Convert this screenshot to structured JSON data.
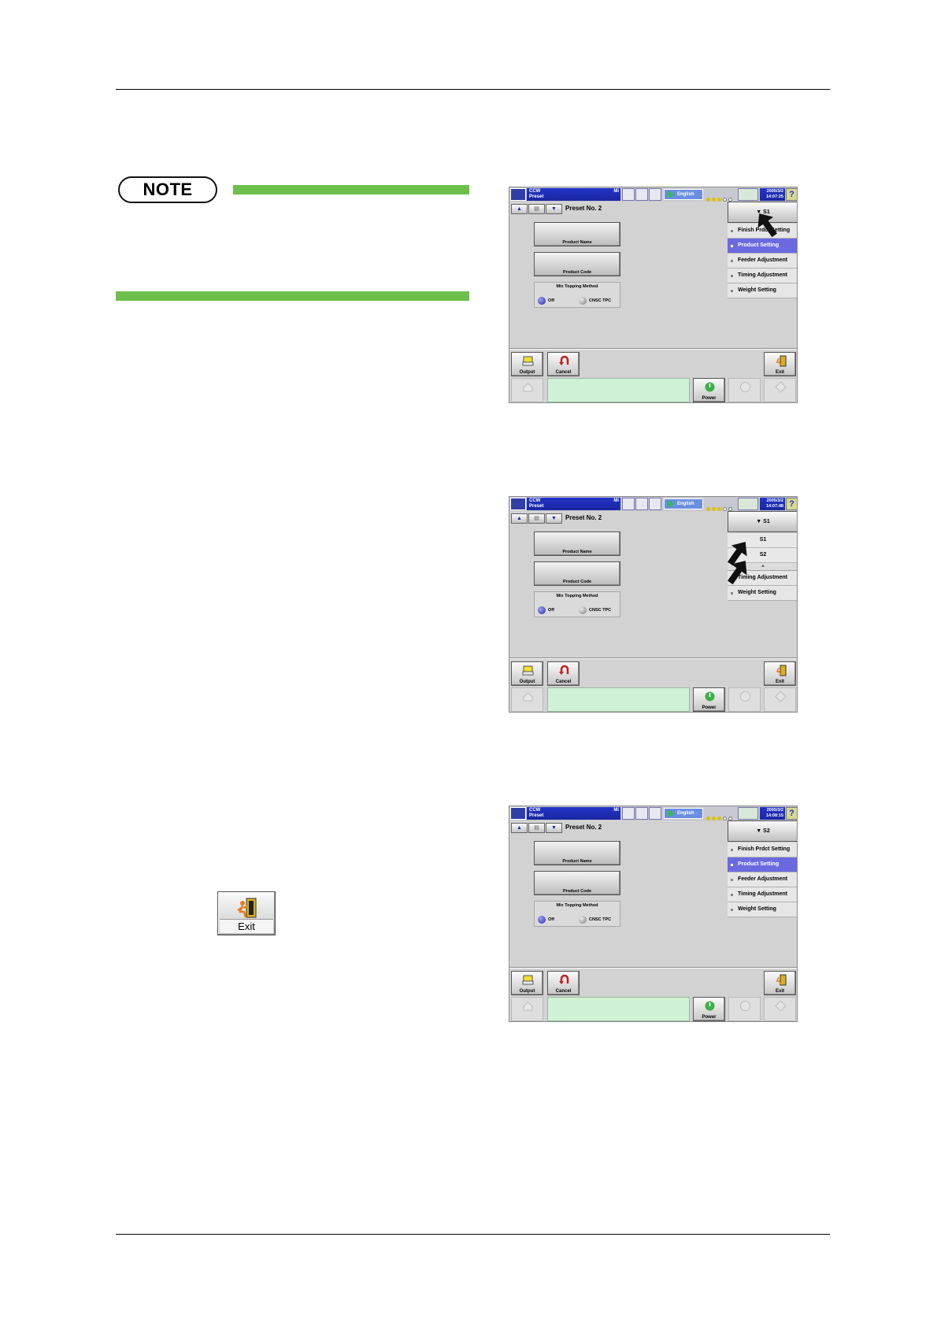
{
  "note": {
    "label": "NOTE"
  },
  "exit_button": {
    "label": "Exit"
  },
  "screens": [
    {
      "mode_line1": "CCW",
      "mode_line2": "Preset",
      "mode_flag": "Mi",
      "language": "English",
      "date": "2005/3/2",
      "time": "14:07:25",
      "preset_title": "Preset No. 2",
      "product_name_label": "Product Name",
      "product_code_label": "Product Code",
      "mix_title": "Mix Topping Method",
      "radio_off": "Off",
      "radio_cnsc": "CNSC TPC",
      "dropdown": "▼ S1",
      "menu": [
        "Finish Prdct Setting",
        "Product Setting",
        "Feeder Adjustment",
        "Timing Adjustment",
        "Weight Setting"
      ],
      "selected_index": 1,
      "btn_output": "Output",
      "btn_cancel": "Cancel",
      "btn_exit": "Exit",
      "btn_power": "Power"
    },
    {
      "mode_line1": "CCW",
      "mode_line2": "Preset",
      "mode_flag": "Mi",
      "language": "English",
      "date": "2005/3/2",
      "time": "14:07:48",
      "preset_title": "Preset No. 2",
      "product_name_label": "Product Name",
      "product_code_label": "Product Code",
      "mix_title": "Mix Topping Method",
      "radio_off": "Off",
      "radio_cnsc": "CNSC TPC",
      "dropdown": "▼ S1",
      "sub_options": [
        "S1",
        "S2"
      ],
      "menu": [
        "Timing Adjustment",
        "Weight Setting"
      ],
      "btn_output": "Output",
      "btn_cancel": "Cancel",
      "btn_exit": "Exit",
      "btn_power": "Power"
    },
    {
      "mode_line1": "CCW",
      "mode_line2": "Preset",
      "mode_flag": "Mi",
      "language": "English",
      "date": "2005/3/2",
      "time": "14:08:15",
      "preset_title": "Preset No. 2",
      "product_name_label": "Product Name",
      "product_code_label": "Product Code",
      "mix_title": "Mix Topping Method",
      "radio_off": "Off",
      "radio_cnsc": "CNSC TPC",
      "dropdown": "▼ S2",
      "menu": [
        "Finish Prdct Setting",
        "Product Setting",
        "Feeder Adjustment",
        "Timing Adjustment",
        "Weight Setting"
      ],
      "selected_index": 1,
      "btn_output": "Output",
      "btn_cancel": "Cancel",
      "btn_exit": "Exit",
      "btn_power": "Power"
    }
  ],
  "colors": {
    "note_bar": "#6cbf4a",
    "title_blue": "#1a27a0",
    "menu_selected": "#6a6ae0",
    "message_area": "#cff2d6"
  }
}
